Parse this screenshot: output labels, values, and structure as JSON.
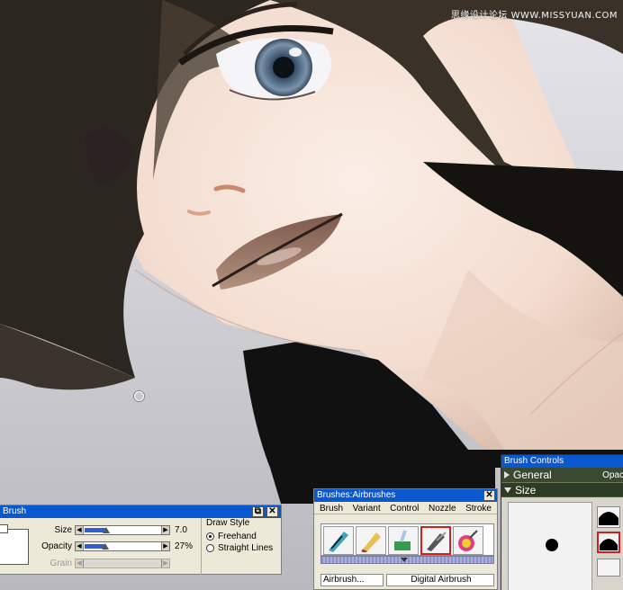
{
  "watermark": "思缘设计论坛 WWW.MISSYUAN.COM",
  "property_bar": {
    "title": "Brush",
    "size": {
      "label": "Size",
      "value": "7.0",
      "level": 0.28
    },
    "opacity": {
      "label": "Opacity",
      "value": "27%",
      "level": 0.27
    },
    "grain": {
      "label": "Grain"
    },
    "draw_style": {
      "label": "Draw Style",
      "options": [
        {
          "label": "Freehand",
          "selected": true
        },
        {
          "label": "Straight Lines",
          "selected": false
        }
      ]
    }
  },
  "brush_selector": {
    "title": "Brushes:Airbrushes",
    "menu": [
      "Brush",
      "Variant",
      "Control",
      "Nozzle",
      "Stroke"
    ],
    "category": "Airbrush...",
    "variant": "Digital Airbrush",
    "selected_index": 3
  },
  "brush_controls": {
    "title": "Brush Controls",
    "general_label": "General",
    "general_value": "Opac",
    "size_label": "Size"
  },
  "colors": {
    "title_blue": "#0a58d0",
    "palette_bg": "#ece9d8",
    "slider_fill": "#2f5fc8",
    "select_red": "#d02020"
  }
}
